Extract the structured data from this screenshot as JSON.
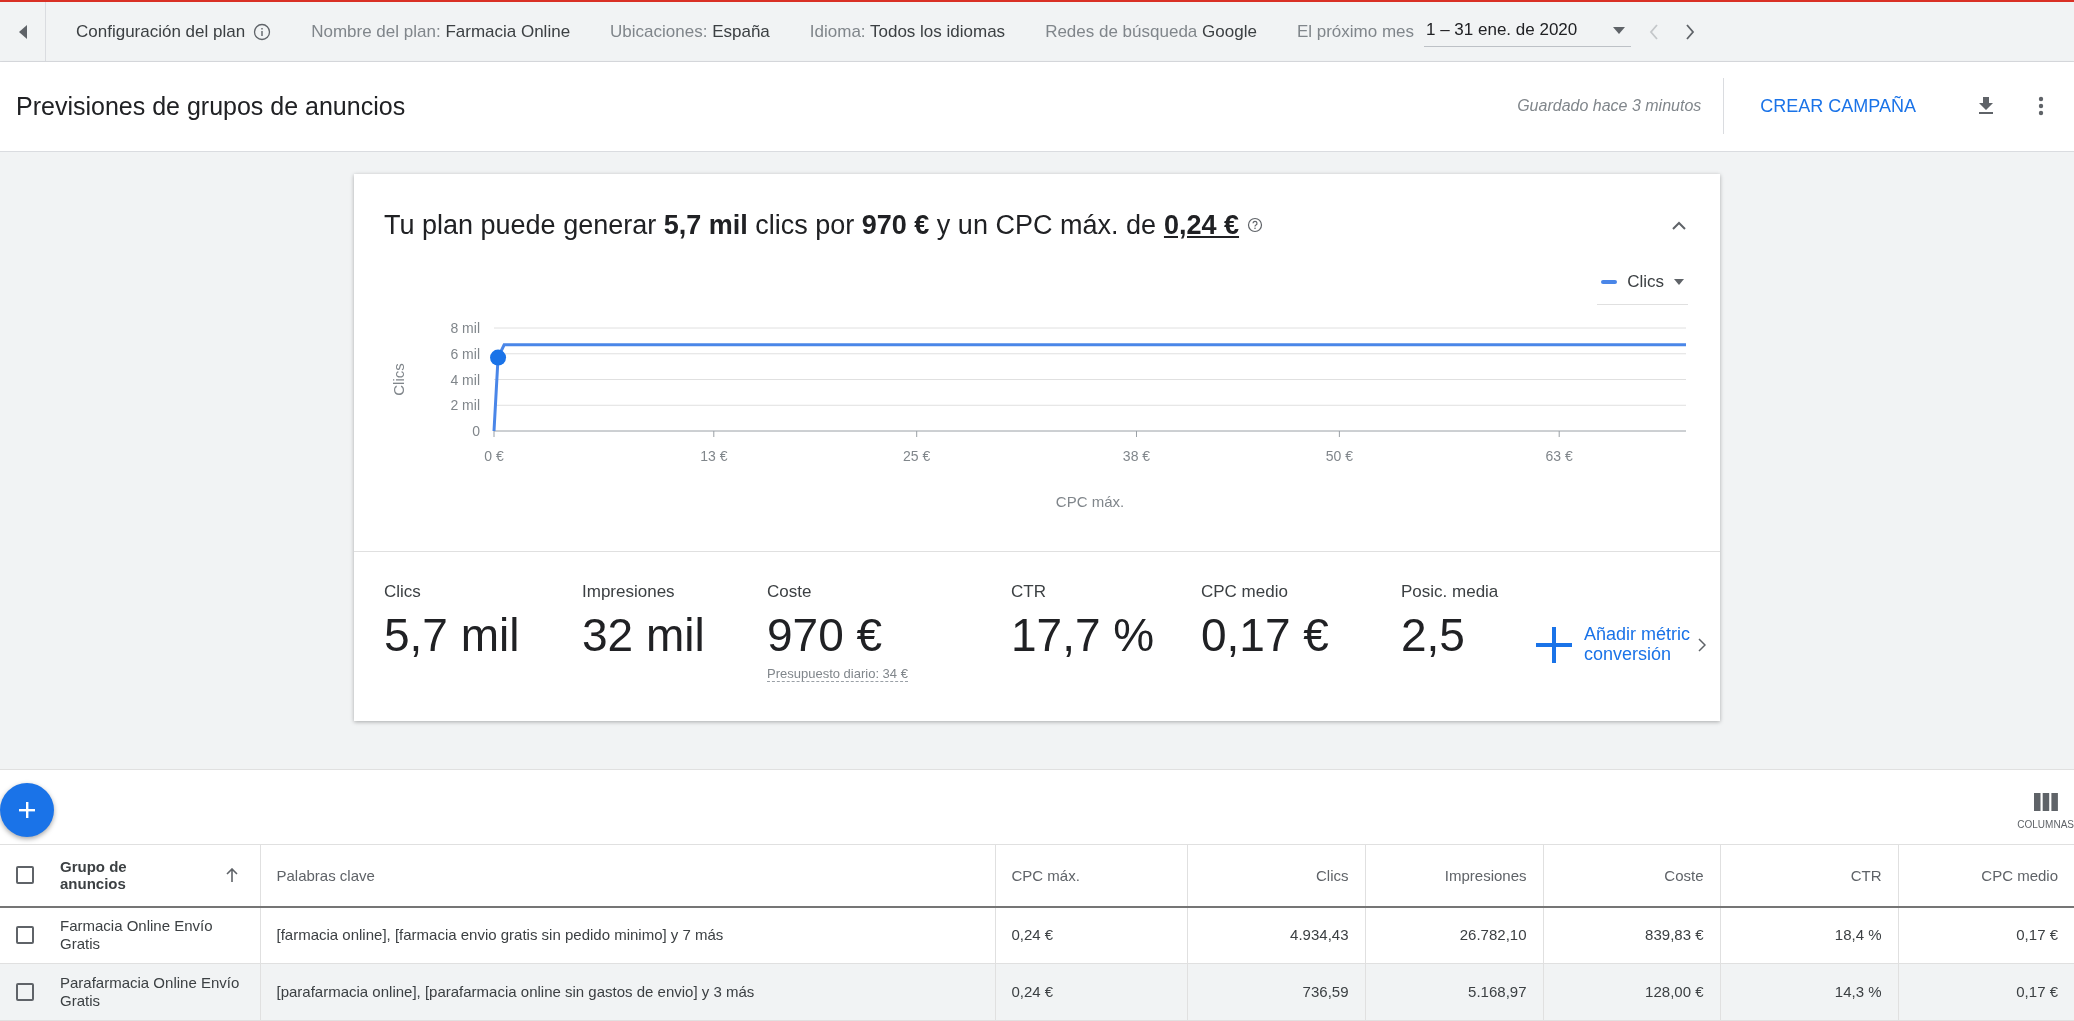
{
  "top_bar": {
    "plan_config": "Configuración del plan",
    "settings": [
      {
        "label": "Nombre del plan:",
        "value": "Farmacia Online"
      },
      {
        "label": "Ubicaciones:",
        "value": "España"
      },
      {
        "label": "Idioma:",
        "value": "Todos los idiomas"
      },
      {
        "label": "Redes de búsqueda",
        "value": "Google"
      }
    ],
    "date_range": {
      "label": "El próximo mes",
      "value": "1 – 31 ene. de 2020"
    },
    "prev_disabled": true,
    "next_disabled": false
  },
  "header": {
    "title": "Previsiones de grupos de anuncios",
    "saved": "Guardado hace 3 minutos",
    "create_button": "CREAR CAMPAÑA"
  },
  "forecast": {
    "headline": "Tu plan puede generar **5,7 mil** clics por **970 €** y un CPC máx. de",
    "headline_link": "0,24 €",
    "expanded": true,
    "chart_data": {
      "type": "line",
      "xlabel": "CPC máx.",
      "ylabel": "Clics",
      "x": [
        0,
        0.24,
        0.6,
        70.5
      ],
      "series": [
        {
          "name": "Clics",
          "color": "#4a86e8",
          "values": [
            0,
            5.7,
            6.7,
            6.7
          ]
        }
      ],
      "xlim": [
        0,
        70.5
      ],
      "ylim": [
        0,
        8
      ],
      "xticks": [
        {
          "value": 0,
          "label": "0 €"
        },
        {
          "value": 13,
          "label": "13 €"
        },
        {
          "value": 25,
          "label": "25 €"
        },
        {
          "value": 38,
          "label": "38 €"
        },
        {
          "value": 50,
          "label": "50 €"
        },
        {
          "value": 63,
          "label": "63 €"
        }
      ],
      "yticks": [
        {
          "value": 0,
          "label": "0"
        },
        {
          "value": 2,
          "label": "2 mil"
        },
        {
          "value": 4,
          "label": "4 mil"
        },
        {
          "value": 6,
          "label": "6 mil"
        },
        {
          "value": 8,
          "label": "8 mil"
        }
      ],
      "grid": true
    },
    "metrics": [
      {
        "label": "Clics",
        "value": "5,7 mil"
      },
      {
        "label": "Impresiones",
        "value": "32 mil"
      },
      {
        "label": "Coste",
        "value": "970 €",
        "note": "Presupuesto diario: 34 €"
      },
      {
        "label": "CTR",
        "value": "17,7 %"
      },
      {
        "label": "CPC medio",
        "value": "0,17 €"
      },
      {
        "label": "Posic. media",
        "value": "2,5"
      }
    ],
    "add_metric": {
      "line1": "Añadir métric",
      "line2": "conversión"
    }
  },
  "table": {
    "columns_button": "COLUMNAS",
    "all_checked": false,
    "columns": [
      {
        "label": "Grupo de anuncios",
        "sorted": true
      },
      {
        "label": "Palabras clave",
        "sorted": false
      },
      {
        "label": "CPC máx.",
        "sorted": false
      },
      {
        "label": "Clics",
        "sorted": false
      },
      {
        "label": "Impresiones",
        "sorted": false
      },
      {
        "label": "Coste",
        "sorted": false
      },
      {
        "label": "CTR",
        "sorted": false
      },
      {
        "label": "CPC medio",
        "sorted": false
      }
    ],
    "rows": [
      {
        "checked": false,
        "highlighted": false,
        "cells": [
          "Farmacia Online Envío Gratis",
          "[farmacia online], [farmacia envio gratis sin pedido minimo] y 7 más",
          "0,24 €",
          "4.934,43",
          "26.782,10",
          "839,83 €",
          "18,4 %",
          "0,17 €"
        ]
      },
      {
        "checked": false,
        "highlighted": true,
        "cells": [
          "Parafarmacia Online Envío Gratis",
          "[parafarmacia online], [parafarmacia online sin gastos de envio] y 3 más",
          "0,24 €",
          "736,59",
          "5.168,97",
          "128,00 €",
          "14,3 %",
          "0,17 €"
        ]
      }
    ]
  }
}
